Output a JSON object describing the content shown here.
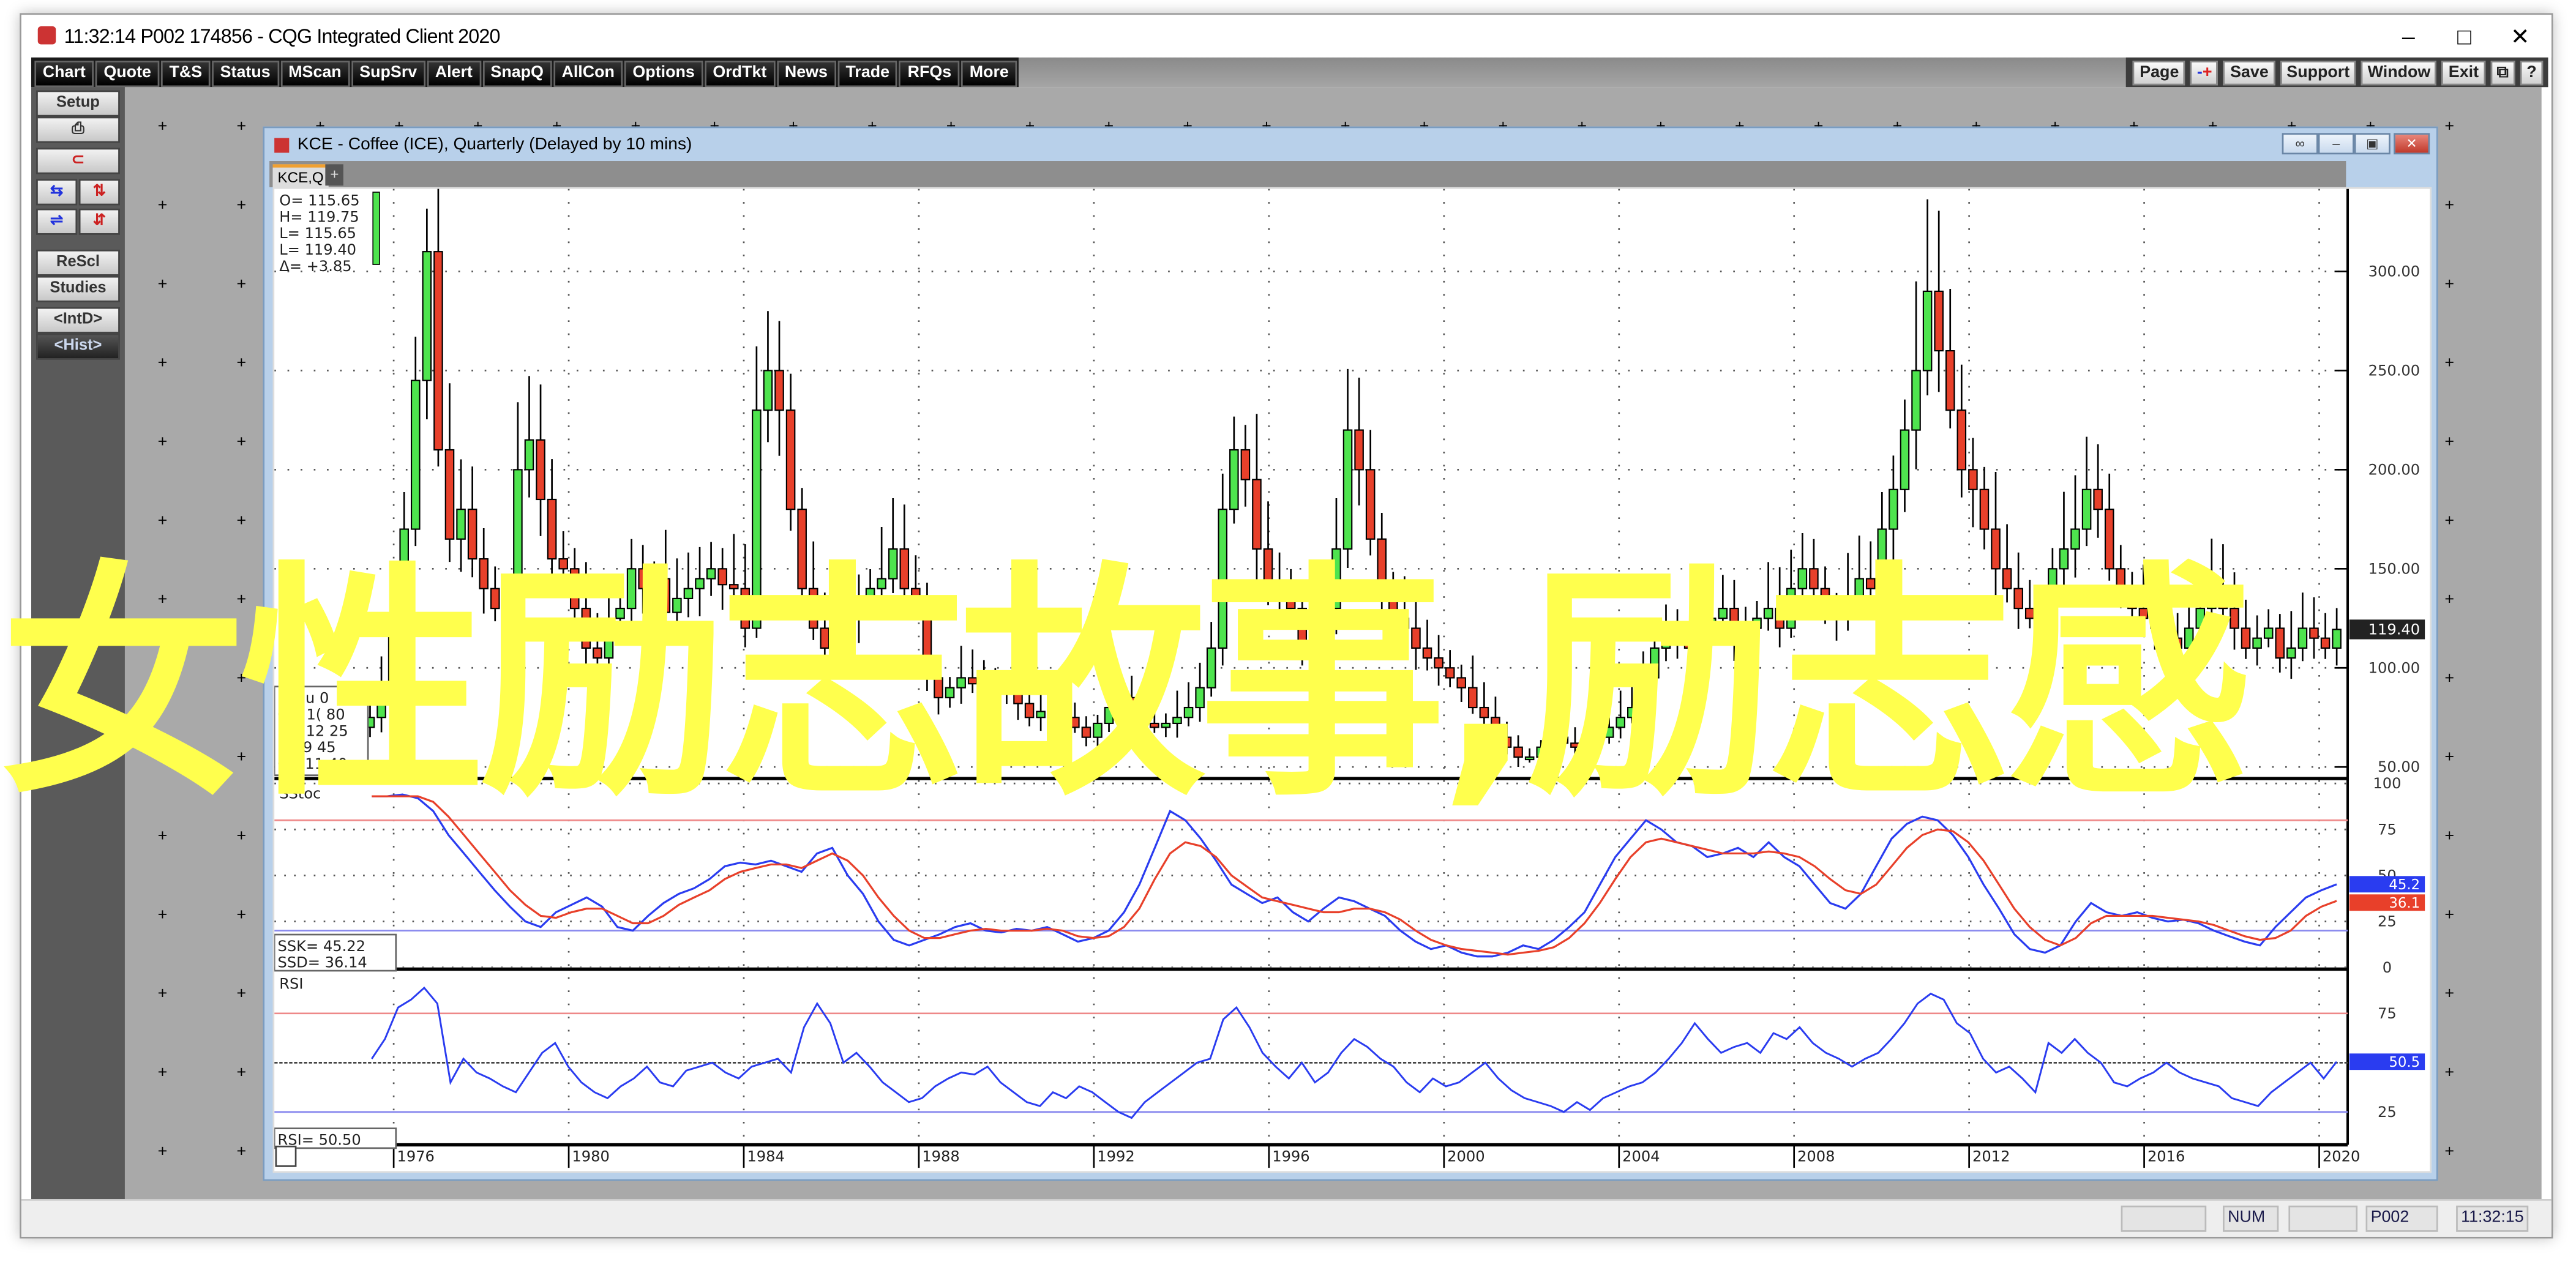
{
  "app": {
    "title": "11:32:14   P002   174856 - CQG Integrated Client 2020",
    "window_controls": [
      "minimize",
      "maximize",
      "close"
    ]
  },
  "toolbar_left": [
    "Chart",
    "Quote",
    "T&S",
    "Status",
    "MScan",
    "SupSrv",
    "Alert",
    "SnapQ",
    "AllCon",
    "Options",
    "OrdTkt",
    "News",
    "Trade",
    "RFQs",
    "More"
  ],
  "toolbar_right": [
    "Page",
    "-+",
    "Save",
    "Support",
    "Window",
    "Exit",
    "restore-icon",
    "?"
  ],
  "sidebar": {
    "setup": "Setup",
    "print_icon": "printer-icon",
    "magnet_icon": "magnet-icon",
    "icons_row1": [
      "horizontal-expand-icon",
      "vertical-expand-icon"
    ],
    "icons_row2": [
      "horizontal-compress-icon",
      "vertical-compress-icon"
    ],
    "rescl": "ReScl",
    "studies": "Studies",
    "intd": "<IntD>",
    "hist": "<Hist>"
  },
  "chart_window": {
    "title": "KCE - Coffee (ICE), Quarterly (Delayed by 10 mins)",
    "tab": "KCE,Q",
    "add_tab": "+",
    "ohlc_readout": [
      "O=  115.65",
      "H=  119.75",
      "L=  115.65",
      "L=  119.40",
      "Δ=   +3.85"
    ],
    "cursor_readout": [
      "01  Ju    0",
      "O=   1(  80",
      "H=   12  25",
      "L=     9  45",
      "C=   11  40"
    ],
    "last_price_label": "119.40",
    "stoch_label": "SStoc",
    "ssk": "SSK=     45.22",
    "ssd": "SSD=     36.14",
    "ssk_badge": "45.2",
    "ssd_badge": "36.1",
    "rsi_label": "RSI",
    "rsi_readout": "RSI=     50.50",
    "rsi_badge": "50.5"
  },
  "status_bar": [
    "",
    "NUM",
    "",
    "P002",
    "11:32:15"
  ],
  "overlay_text": "女性励志故事,励志感",
  "colors": {
    "up": "#4ee44e",
    "down": "#e8402a",
    "ssk": "#2a3cf0",
    "ssd": "#e8402a",
    "rsi": "#2a3cf0",
    "overlay": "#ffff4d"
  },
  "chart_data": [
    {
      "type": "candlestick",
      "title": "KCE - Coffee (ICE), Quarterly",
      "ylim": [
        45,
        340
      ],
      "yticks": [
        "300.00",
        "250.00",
        "200.00",
        "150.00",
        "100.00",
        "50.00"
      ],
      "xticks": [
        "1976",
        "1980",
        "1984",
        "1988",
        "1992",
        "1996",
        "2000",
        "2004",
        "2008",
        "2012",
        "2016",
        "2020"
      ],
      "x_range": [
        1975.0,
        2020.5
      ],
      "closes": [
        70,
        75,
        92,
        120,
        170,
        245,
        310,
        210,
        165,
        180,
        155,
        140,
        130,
        120,
        200,
        215,
        185,
        155,
        150,
        130,
        110,
        105,
        125,
        130,
        150,
        140,
        145,
        128,
        135,
        140,
        145,
        150,
        142,
        140,
        120,
        230,
        250,
        230,
        180,
        140,
        120,
        110,
        115,
        125,
        135,
        140,
        145,
        160,
        140,
        130,
        95,
        85,
        90,
        95,
        92,
        90,
        88,
        90,
        82,
        75,
        78,
        80,
        75,
        70,
        65,
        72,
        80,
        85,
        80,
        72,
        70,
        72,
        75,
        80,
        90,
        110,
        180,
        210,
        195,
        160,
        140,
        135,
        130,
        110,
        120,
        130,
        160,
        220,
        200,
        165,
        140,
        125,
        120,
        110,
        105,
        100,
        95,
        90,
        80,
        75,
        65,
        60,
        55,
        55,
        60,
        65,
        62,
        60,
        62,
        65,
        70,
        75,
        80,
        95,
        110,
        120,
        115,
        110,
        120,
        125,
        130,
        115,
        120,
        125,
        130,
        120,
        140,
        150,
        140,
        130,
        125,
        135,
        145,
        140,
        170,
        190,
        220,
        250,
        290,
        260,
        230,
        200,
        190,
        170,
        150,
        140,
        130,
        125,
        130,
        150,
        160,
        170,
        190,
        180,
        150,
        140,
        130,
        125,
        120,
        115,
        110,
        120,
        130,
        140,
        130,
        120,
        110,
        115,
        120,
        105,
        110,
        120,
        115,
        110,
        119.4
      ],
      "last": 119.4
    },
    {
      "type": "line",
      "title": "SStoc",
      "ylim": [
        0,
        100
      ],
      "yticks": [
        "100",
        "75",
        "50",
        "25",
        "0"
      ],
      "reference_lines": [
        80,
        20
      ],
      "series": [
        {
          "name": "SSK",
          "color": "#2a3cf0",
          "values": [
            93,
            93,
            94,
            92,
            85,
            72,
            62,
            52,
            42,
            33,
            25,
            22,
            30,
            34,
            38,
            33,
            22,
            20,
            28,
            35,
            40,
            43,
            48,
            55,
            57,
            56,
            58,
            55,
            52,
            62,
            65,
            50,
            40,
            25,
            15,
            12,
            15,
            18,
            22,
            24,
            20,
            19,
            21,
            20,
            22,
            18,
            14,
            16,
            20,
            30,
            45,
            65,
            85,
            80,
            70,
            58,
            45,
            40,
            35,
            38,
            30,
            25,
            32,
            38,
            36,
            32,
            28,
            20,
            14,
            10,
            12,
            8,
            6,
            6,
            8,
            12,
            10,
            15,
            22,
            30,
            45,
            60,
            70,
            80,
            75,
            68,
            66,
            60,
            62,
            65,
            60,
            68,
            60,
            55,
            45,
            35,
            32,
            40,
            55,
            70,
            78,
            82,
            80,
            72,
            60,
            45,
            32,
            18,
            10,
            8,
            12,
            25,
            35,
            30,
            28,
            30,
            27,
            25,
            26,
            24,
            20,
            17,
            14,
            12,
            22,
            30,
            38,
            42,
            45.22
          ]
        },
        {
          "name": "SSD",
          "color": "#e8402a",
          "values": [
            93,
            93,
            93,
            93,
            90,
            82,
            72,
            62,
            52,
            42,
            34,
            28,
            27,
            30,
            32,
            32,
            28,
            24,
            24,
            28,
            34,
            38,
            42,
            48,
            52,
            54,
            56,
            56,
            54,
            58,
            62,
            58,
            50,
            38,
            28,
            20,
            16,
            16,
            18,
            20,
            21,
            20,
            20,
            20,
            21,
            20,
            17,
            16,
            17,
            22,
            32,
            48,
            62,
            68,
            66,
            60,
            50,
            44,
            38,
            36,
            34,
            32,
            30,
            30,
            32,
            32,
            30,
            26,
            20,
            15,
            12,
            10,
            9,
            8,
            7,
            8,
            9,
            11,
            16,
            24,
            35,
            48,
            60,
            68,
            70,
            68,
            66,
            64,
            62,
            62,
            62,
            63,
            62,
            60,
            55,
            48,
            42,
            40,
            45,
            55,
            65,
            72,
            75,
            74,
            68,
            58,
            45,
            32,
            22,
            15,
            12,
            16,
            24,
            28,
            28,
            28,
            28,
            27,
            26,
            25,
            23,
            20,
            17,
            15,
            16,
            20,
            28,
            33,
            36.14
          ]
        }
      ],
      "last": {
        "SSK": 45.22,
        "SSD": 36.14
      }
    },
    {
      "type": "line",
      "title": "RSI",
      "ylim": [
        10,
        95
      ],
      "yticks": [
        "75",
        "25"
      ],
      "reference_lines": [
        75,
        50,
        25
      ],
      "series": [
        {
          "name": "RSI",
          "color": "#2a3cf0",
          "values": [
            52,
            62,
            78,
            82,
            88,
            80,
            40,
            52,
            45,
            42,
            38,
            35,
            45,
            55,
            60,
            48,
            40,
            35,
            32,
            38,
            42,
            48,
            40,
            38,
            46,
            48,
            50,
            45,
            42,
            48,
            50,
            52,
            45,
            68,
            80,
            70,
            50,
            55,
            48,
            40,
            35,
            30,
            32,
            38,
            42,
            45,
            44,
            48,
            40,
            35,
            30,
            28,
            35,
            32,
            38,
            35,
            30,
            25,
            22,
            30,
            35,
            40,
            45,
            50,
            52,
            72,
            78,
            68,
            55,
            48,
            42,
            50,
            40,
            45,
            55,
            62,
            58,
            52,
            48,
            40,
            35,
            42,
            38,
            40,
            45,
            50,
            42,
            36,
            32,
            30,
            28,
            25,
            30,
            26,
            32,
            35,
            38,
            40,
            45,
            52,
            60,
            70,
            62,
            55,
            58,
            60,
            55,
            65,
            62,
            68,
            60,
            55,
            52,
            48,
            52,
            55,
            62,
            70,
            80,
            85,
            82,
            70,
            65,
            52,
            45,
            48,
            42,
            35,
            60,
            55,
            62,
            55,
            50,
            40,
            38,
            42,
            45,
            50,
            45,
            42,
            40,
            38,
            32,
            30,
            28,
            35,
            40,
            45,
            50,
            42,
            50.5
          ]
        }
      ],
      "last": 50.5
    }
  ]
}
